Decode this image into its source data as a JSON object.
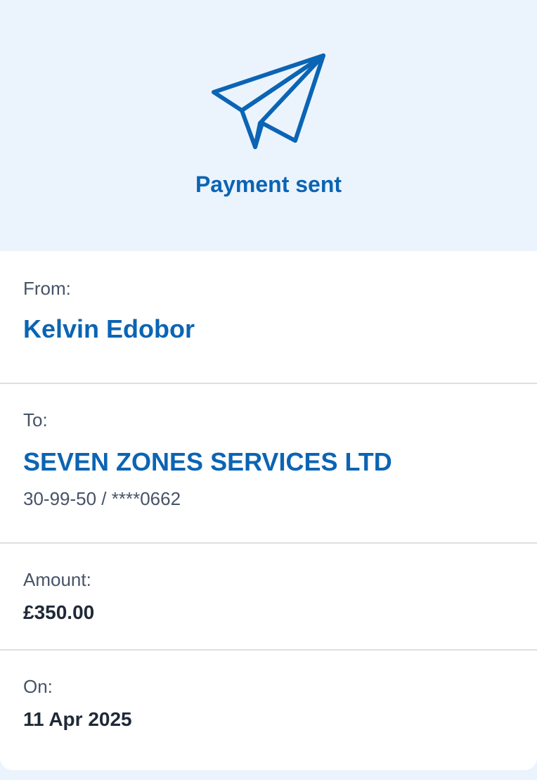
{
  "header": {
    "title": "Payment sent",
    "icon": "paper-plane-icon",
    "accent_color": "#0b64b4",
    "background_color": "#ebf4fc"
  },
  "from": {
    "label": "From:",
    "name": "Kelvin Edobor"
  },
  "to": {
    "label": "To:",
    "name": "SEVEN ZONES SERVICES LTD",
    "account": "30-99-50 / ****0662"
  },
  "amount": {
    "label": "Amount:",
    "value": "£350.00"
  },
  "date": {
    "label": "On:",
    "value": "11 Apr 2025"
  }
}
